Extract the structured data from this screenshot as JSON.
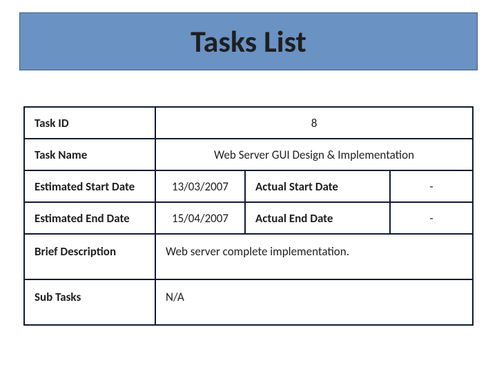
{
  "title": "Tasks List",
  "labels": {
    "task_id": "Task ID",
    "task_name": "Task Name",
    "est_start": "Estimated Start Date",
    "est_end": "Estimated End Date",
    "actual_start": "Actual Start Date",
    "actual_end": "Actual End Date",
    "brief_desc": "Brief  Description",
    "sub_tasks": "Sub Tasks"
  },
  "values": {
    "task_id": "8",
    "task_name": "Web Server GUI Design & Implementation",
    "est_start": "13/03/2007",
    "est_end": "15/04/2007",
    "actual_start": "-",
    "actual_end": "-",
    "brief_desc": "Web server complete implementation.",
    "sub_tasks": "N/A"
  }
}
